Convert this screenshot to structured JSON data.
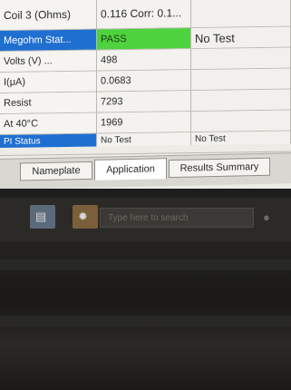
{
  "grid": {
    "rows": [
      {
        "label": "Coil 3 (Ohms)",
        "value": "0.116 Corr: 0.1...",
        "extra": ""
      },
      {
        "label": "Megohm Stat...",
        "value": "PASS",
        "extra": "No Test"
      },
      {
        "label": "Volts (V) ...",
        "value": "498",
        "extra": ""
      },
      {
        "label": "I(μA)",
        "value": "0.0683",
        "extra": ""
      },
      {
        "label": "Resist",
        "value": "7293",
        "extra": ""
      },
      {
        "label": "At 40°C",
        "value": "1969",
        "extra": ""
      },
      {
        "label": "PI Status",
        "value": "No Test",
        "extra": "No Test"
      }
    ]
  },
  "tabs": {
    "nameplate": "Nameplate",
    "application": "Application",
    "results_summary": "Results Summary"
  },
  "taskbar": {
    "search_text": "Type here to search"
  },
  "colors": {
    "pass": "#4ed23e",
    "selected": "#1f6fd1"
  }
}
